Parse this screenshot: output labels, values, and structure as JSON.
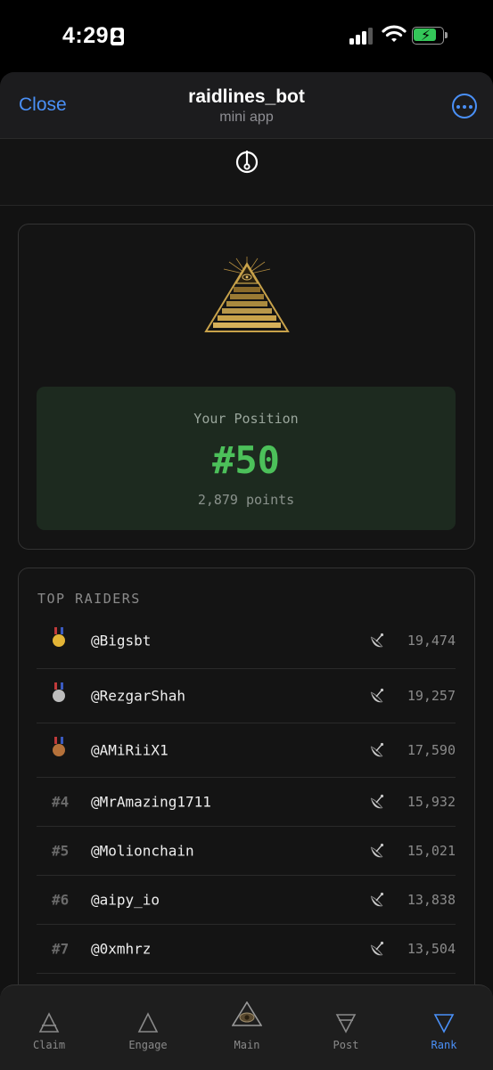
{
  "status": {
    "time": "4:29"
  },
  "header": {
    "close_label": "Close",
    "title": "raidlines_bot",
    "subtitle": "mini app"
  },
  "position": {
    "label": "Your Position",
    "rank": "#50",
    "points": "2,879 points"
  },
  "raiders": {
    "title": "TOP RAIDERS",
    "rows": [
      {
        "rank": "1",
        "medal": "gold",
        "user": "@Bigsbt",
        "score": "19,474"
      },
      {
        "rank": "2",
        "medal": "silver",
        "user": "@RezgarShah",
        "score": "19,257"
      },
      {
        "rank": "3",
        "medal": "bronze",
        "user": "@AMiRiiX1",
        "score": "17,590"
      },
      {
        "rank": "#4",
        "user": "@MrAmazing1711",
        "score": "15,932"
      },
      {
        "rank": "#5",
        "user": "@Molionchain",
        "score": "15,021"
      },
      {
        "rank": "#6",
        "user": "@aipy_io",
        "score": "13,838"
      },
      {
        "rank": "#7",
        "user": "@0xmhrz",
        "score": "13,504"
      }
    ]
  },
  "tabs": [
    {
      "label": "Claim",
      "icon": "triangle-claim-icon",
      "active": false
    },
    {
      "label": "Engage",
      "icon": "triangle-engage-icon",
      "active": false
    },
    {
      "label": "Main",
      "icon": "eye-pyramid-icon",
      "active": false
    },
    {
      "label": "Post",
      "icon": "triangle-post-icon",
      "active": false
    },
    {
      "label": "Rank",
      "icon": "triangle-rank-icon",
      "active": true
    }
  ],
  "colors": {
    "accent": "#4a90f7",
    "position_green": "#4cc05a",
    "gold": "#c8a24a"
  }
}
